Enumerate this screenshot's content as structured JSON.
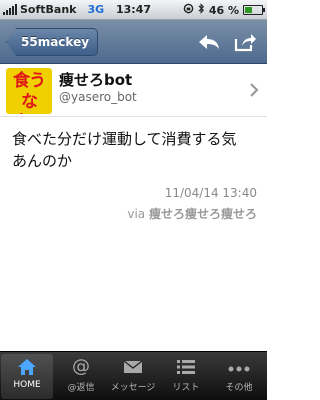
{
  "status_bar": {
    "carrier": "SoftBank",
    "network": "3G",
    "time": "13:47",
    "battery": "46 %",
    "battery_level": 0.46
  },
  "nav": {
    "back_label": "55mackey"
  },
  "tweet": {
    "avatar_text_line1": "食う",
    "avatar_text_line2": "なよ。",
    "display_name": "痩せろbot",
    "handle": "@yasero_bot",
    "text_line1": "食べた分だけ運動して消費する気",
    "text_line2": "あんのか",
    "timestamp": "11/04/14 13:40",
    "via_prefix": "via",
    "via_source": "痩せろ痩せろ痩せろ"
  },
  "tabs": [
    {
      "label": "HOME",
      "icon": "home-icon"
    },
    {
      "label": "@返信",
      "icon": "at-icon"
    },
    {
      "label": "メッセージ",
      "icon": "envelope-icon"
    },
    {
      "label": "リスト",
      "icon": "list-icon"
    },
    {
      "label": "その他",
      "icon": "more-icon"
    }
  ],
  "colors": {
    "nav_blue": "#4d6a8e",
    "accent_blue": "#4aa6ff",
    "avatar_yellow": "#f0d000",
    "avatar_red": "#e01818"
  }
}
